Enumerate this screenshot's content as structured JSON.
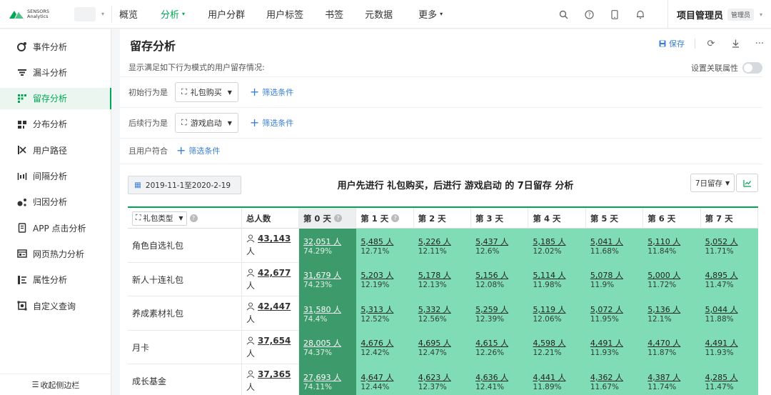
{
  "topbar": {
    "logo_line1": "SENSORS",
    "logo_line2": "Analytics",
    "nav": [
      {
        "label": "概览",
        "active": false,
        "caret": false
      },
      {
        "label": "分析",
        "active": true,
        "caret": true
      },
      {
        "label": "用户分群",
        "active": false,
        "caret": false
      },
      {
        "label": "用户标签",
        "active": false,
        "caret": false
      },
      {
        "label": "书签",
        "active": false,
        "caret": false
      },
      {
        "label": "元数据",
        "active": false,
        "caret": false
      },
      {
        "label": "更多",
        "active": false,
        "caret": true
      }
    ],
    "icons": [
      "search-icon",
      "help-icon",
      "mobile-icon",
      "bell-icon"
    ],
    "user_name": "项目管理员",
    "role": "管理员"
  },
  "sidebar": {
    "items": [
      {
        "label": "事件分析",
        "icon": "event-analysis-icon",
        "active": false
      },
      {
        "label": "漏斗分析",
        "icon": "funnel-icon",
        "active": false
      },
      {
        "label": "留存分析",
        "icon": "retention-icon",
        "active": true
      },
      {
        "label": "分布分析",
        "icon": "distribution-icon",
        "active": false
      },
      {
        "label": "用户路径",
        "icon": "path-icon",
        "active": false
      },
      {
        "label": "间隔分析",
        "icon": "interval-icon",
        "active": false
      },
      {
        "label": "归因分析",
        "icon": "attribution-icon",
        "active": false
      },
      {
        "label": "APP 点击分析",
        "icon": "app-click-icon",
        "active": false
      },
      {
        "label": "网页热力分析",
        "icon": "heatmap-icon",
        "active": false
      },
      {
        "label": "属性分析",
        "icon": "attribute-icon",
        "active": false
      },
      {
        "label": "自定义查询",
        "icon": "query-icon",
        "active": false
      }
    ],
    "collapse_label": "收起侧边栏"
  },
  "main": {
    "title": "留存分析",
    "save_label": "保存",
    "description": "显示满足如下行为模式的用户留存情况:",
    "toggle_label": "设置关联属性",
    "initial_label": "初始行为是",
    "initial_event": "礼包购买",
    "followup_label": "后续行为是",
    "followup_event": "游戏启动",
    "user_match_label": "且用户符合",
    "add_filter_label": "筛选条件",
    "date_range": "2019-11-1至2020-2-19",
    "chart_title": "用户先进行 礼包购买，后进行 游戏启动 的 7日留存 分析",
    "retention_select": "7日留存"
  },
  "table": {
    "group_select": "礼包类型",
    "headers": [
      "总人数",
      "第 0 天",
      "第 1 天",
      "第 2 天",
      "第 3 天",
      "第 4 天",
      "第 5 天",
      "第 6 天",
      "第 7 天"
    ],
    "person_suffix": "人",
    "rows": [
      {
        "name": "角色自选礼包",
        "total": "43,143",
        "cells": [
          [
            "32,051 人",
            "74.29%"
          ],
          [
            "5,485 人",
            "12.71%"
          ],
          [
            "5,226 人",
            "12.11%"
          ],
          [
            "5,437 人",
            "12.6%"
          ],
          [
            "5,185 人",
            "12.02%"
          ],
          [
            "5,041 人",
            "11.68%"
          ],
          [
            "5,110 人",
            "11.84%"
          ],
          [
            "5,052 人",
            "11.71%"
          ]
        ]
      },
      {
        "name": "新人十连礼包",
        "total": "42,677",
        "cells": [
          [
            "31,679 人",
            "74.23%"
          ],
          [
            "5,203 人",
            "12.19%"
          ],
          [
            "5,178 人",
            "12.13%"
          ],
          [
            "5,156 人",
            "12.08%"
          ],
          [
            "5,114 人",
            "11.98%"
          ],
          [
            "5,078 人",
            "11.9%"
          ],
          [
            "5,000 人",
            "11.72%"
          ],
          [
            "4,895 人",
            "11.47%"
          ]
        ]
      },
      {
        "name": "养成素材礼包",
        "total": "42,447",
        "cells": [
          [
            "31,580 人",
            "74.4%"
          ],
          [
            "5,313 人",
            "12.52%"
          ],
          [
            "5,332 人",
            "12.56%"
          ],
          [
            "5,259 人",
            "12.39%"
          ],
          [
            "5,119 人",
            "12.06%"
          ],
          [
            "5,072 人",
            "11.95%"
          ],
          [
            "5,136 人",
            "12.1%"
          ],
          [
            "5,044 人",
            "11.88%"
          ]
        ]
      },
      {
        "name": "月卡",
        "total": "37,654",
        "cells": [
          [
            "28,005 人",
            "74.37%"
          ],
          [
            "4,676 人",
            "12.42%"
          ],
          [
            "4,695 人",
            "12.47%"
          ],
          [
            "4,615 人",
            "12.26%"
          ],
          [
            "4,598 人",
            "12.21%"
          ],
          [
            "4,491 人",
            "11.93%"
          ],
          [
            "4,470 人",
            "11.87%"
          ],
          [
            "4,491 人",
            "11.93%"
          ]
        ]
      },
      {
        "name": "成长基金",
        "total": "37,365",
        "cells": [
          [
            "27,693 人",
            "74.11%"
          ],
          [
            "4,647 人",
            "12.44%"
          ],
          [
            "4,623 人",
            "12.37%"
          ],
          [
            "4,636 人",
            "12.41%"
          ],
          [
            "4,441 人",
            "11.89%"
          ],
          [
            "4,362 人",
            "11.67%"
          ],
          [
            "4,387 人",
            "11.74%"
          ],
          [
            "4,285 人",
            "11.47%"
          ]
        ]
      }
    ]
  },
  "colors": {
    "accent": "#00a854",
    "link": "#3a7fd6",
    "day0": "#3d9a6a",
    "dayN": "#7fdcb4"
  }
}
